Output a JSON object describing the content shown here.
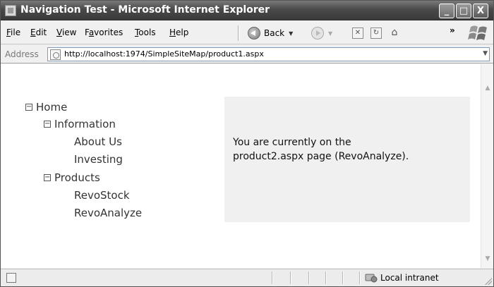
{
  "window": {
    "title": "Navigation Test - Microsoft Internet Explorer",
    "controls": {
      "minimize": "_",
      "maximize": "□",
      "close": "X"
    }
  },
  "menu": {
    "items": [
      {
        "label": "File",
        "accel": "F",
        "rest": "ile"
      },
      {
        "label": "Edit",
        "accel": "E",
        "rest": "dit"
      },
      {
        "label": "View",
        "accel": "V",
        "rest": "iew"
      },
      {
        "label": "Favorites",
        "pre": "F",
        "accel": "a",
        "rest": "vorites"
      },
      {
        "label": "Tools",
        "accel": "T",
        "rest": "ools"
      },
      {
        "label": "Help",
        "accel": "H",
        "rest": "elp"
      }
    ],
    "back_label": "Back",
    "overflow": "»"
  },
  "address": {
    "label": "Address",
    "url": "http://localhost:1974/SimpleSiteMap/product1.aspx"
  },
  "tree": {
    "expander": "−",
    "nodes": [
      {
        "label": "Home",
        "level": 0,
        "expanded": true
      },
      {
        "label": "Information",
        "level": 1,
        "expanded": true
      },
      {
        "label": "About Us",
        "level": 2
      },
      {
        "label": "Investing",
        "level": 2
      },
      {
        "label": "Products",
        "level": 1,
        "expanded": true
      },
      {
        "label": "RevoStock",
        "level": 2
      },
      {
        "label": "RevoAnalyze",
        "level": 2
      }
    ]
  },
  "panel": {
    "line1": "You are currently on the",
    "line2": "product2.aspx page (RevoAnalyze)."
  },
  "status": {
    "zone": "Local intranet"
  },
  "colors": {
    "titlebar": "#4a4a4a",
    "panel_bg": "#f0f0f0",
    "content_bg": "#ffffff"
  }
}
